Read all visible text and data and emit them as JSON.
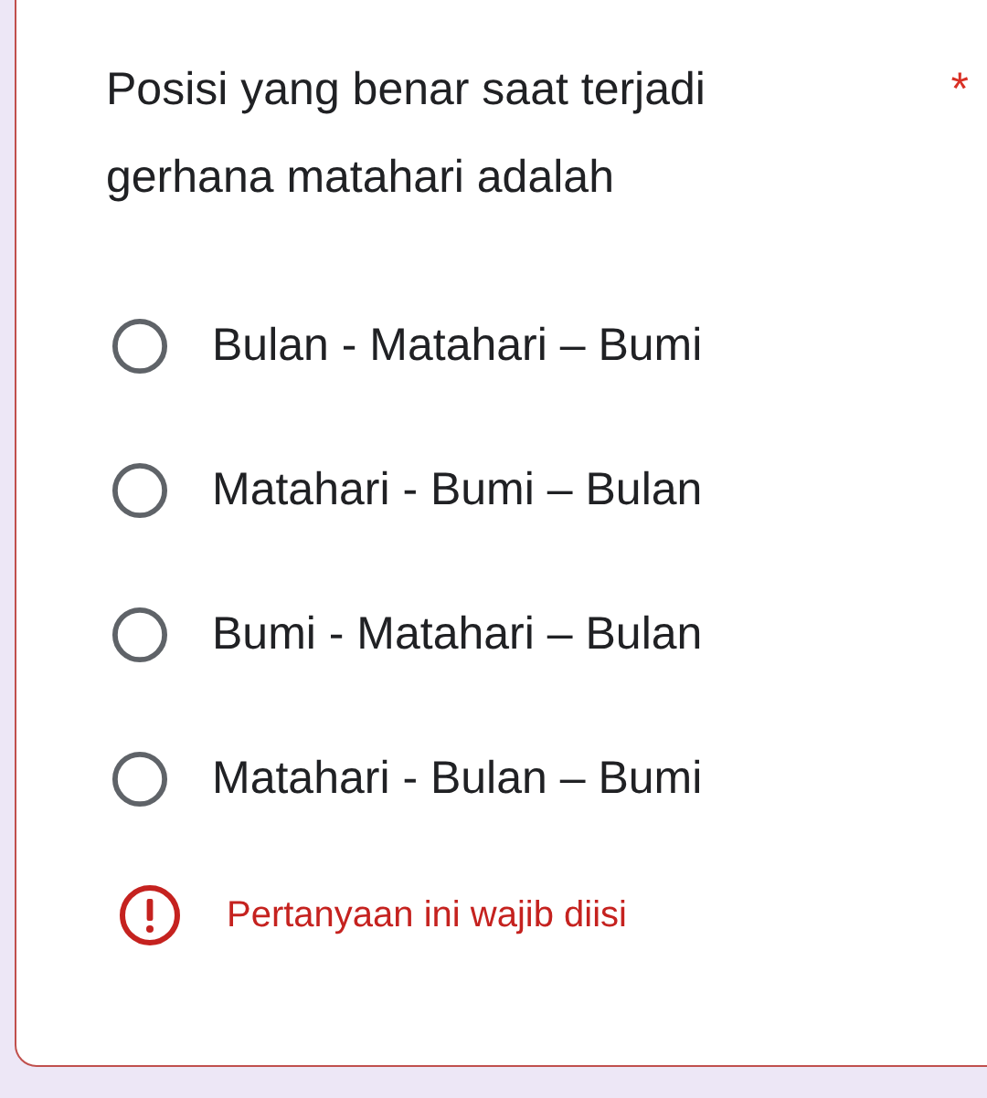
{
  "question": {
    "title": "Posisi yang benar saat terjadi gerhana matahari adalah",
    "required_mark": "*",
    "error": true
  },
  "options": [
    {
      "label": "Bulan - Matahari – Bumi",
      "selected": false
    },
    {
      "label": "Matahari - Bumi – Bulan",
      "selected": false
    },
    {
      "label": "Bumi - Matahari – Bulan",
      "selected": false
    },
    {
      "label": "Matahari - Bulan – Bumi",
      "selected": false
    }
  ],
  "error_message": "Pertanyaan ini wajib diisi"
}
